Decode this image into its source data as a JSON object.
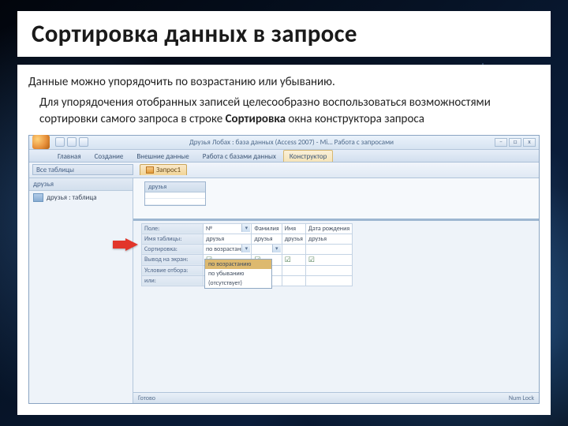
{
  "slide": {
    "title": "Сортировка данных в запросе",
    "p1": "Данные можно упорядочить по возрастанию или убыванию.",
    "p2a": "Для упорядочения отобранных записей целесообразно воспользоваться возможностями сортировки самого запроса в строке ",
    "p2b": "Сортировка",
    "p2c": " окна конструктора запроса"
  },
  "app": {
    "title": "Друзья Лобах : база данных (Access 2007) - Mi…    Работа с запросами",
    "tabs": {
      "home": "Главная",
      "create": "Создание",
      "external": "Внешние данные",
      "dbtools": "Работа с базами данных",
      "design": "Конструктор"
    },
    "navpane": {
      "header": "Все таблицы",
      "group": "друзья",
      "item": "друзья : таблица"
    },
    "obj_tab": "Запрос1",
    "table_box": "друзья",
    "rows": {
      "field": "Поле:",
      "table": "Имя таблицы:",
      "sort": "Сортировка:",
      "show": "Вывод на экран:",
      "criteria": "Условие отбора:",
      "or": "или:"
    },
    "cols": {
      "c1_field": "№",
      "c1_table": "друзья",
      "c2_field": "Фамилия",
      "c2_table": "друзья",
      "c3_field": "Имя",
      "c3_table": "друзья",
      "c4_field": "Дата рождения",
      "c4_table": "друзья"
    },
    "sort_val": "по возрастанию",
    "dropdown": {
      "o1": "по возрастанию",
      "o2": "по убыванию",
      "o3": "(отсутствует)"
    },
    "status": {
      "ready": "Готово",
      "numlock": "Num Lock"
    }
  }
}
